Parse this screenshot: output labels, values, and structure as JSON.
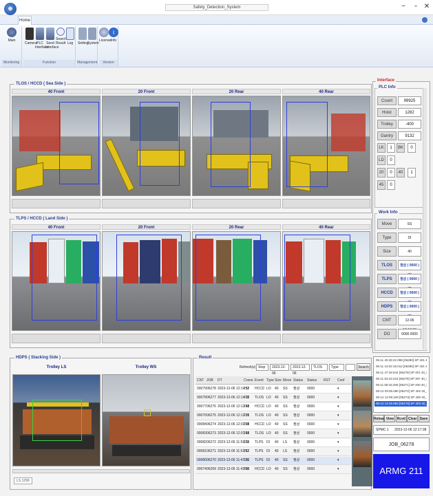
{
  "window": {
    "title": "Safety_Detection_System"
  },
  "ribbon": {
    "tab": "Home",
    "groups": [
      {
        "label": "Monitoring",
        "buttons": [
          "Main"
        ]
      },
      {
        "label": "Function",
        "buttons": [
          "Camera",
          "PLC Interface",
          "Send Interface",
          "Search Result",
          "Log"
        ]
      },
      {
        "label": "Management",
        "buttons": [
          "Setting",
          "System"
        ]
      },
      {
        "label": "Version",
        "buttons": [
          "License",
          "Info"
        ]
      }
    ]
  },
  "sea_side": {
    "title": "TLOS / HCCD ( Sea Side )",
    "cams": [
      "40 Front",
      "20 Front",
      "20 Rear",
      "40 Rear"
    ]
  },
  "land_side": {
    "title": "TLPS / HCCD ( Land Side )",
    "cams": [
      "40 Front",
      "20 Front",
      "20 Rear",
      "40 Rear"
    ]
  },
  "hdps": {
    "title": "HDPS ( Stacking Side )",
    "cams": [
      "Trolley LS",
      "Trolley WS"
    ],
    "scroll_label": "LS 1299"
  },
  "interface": {
    "title": "Interface",
    "plc_info": {
      "title": "PLC Info",
      "rows": [
        {
          "label": "Count",
          "value": "99925"
        },
        {
          "label": "Hoist",
          "value": "1282"
        },
        {
          "label": "Trolley",
          "value": "-400"
        },
        {
          "label": "Gantry",
          "value": "9132"
        }
      ],
      "flags": [
        [
          "LK",
          "1",
          "BK",
          "0"
        ],
        [
          "LD",
          "0",
          "",
          ""
        ],
        [
          "20",
          "0",
          "40",
          "1"
        ],
        [
          "45",
          "0",
          "",
          ""
        ]
      ]
    },
    "work_info": {
      "title": "Work Info",
      "rows": [
        {
          "label": "Move",
          "value": "SS"
        },
        {
          "label": "Type",
          "value": "DI"
        },
        {
          "label": "Size",
          "value": "40"
        },
        {
          "label": "TLOS",
          "value": "정상 ( 0000 ) (0)"
        },
        {
          "label": "TLPS",
          "value": "정상 ( 0000 ) (0)"
        },
        {
          "label": "HCCD",
          "value": "정상 ( 0000 ) (0)"
        },
        {
          "label": "HDPS",
          "value": "정상 ( 0000 ) (0)"
        },
        {
          "label": "CMT",
          "value": "12-06 12:17:38"
        },
        {
          "label": "DO",
          "value": "0000 0000"
        }
      ]
    }
  },
  "result": {
    "title": "Result",
    "refresh_label": "Refresh(s)",
    "refresh_value": "Stop",
    "date_from": "2023-12-06",
    "date_to": "2023-12-06",
    "system": "TLOS",
    "type": "Type",
    "search": "Search",
    "columns": [
      "CNT",
      "JOB",
      "DT",
      "Crane",
      "Event",
      "Type",
      "Size",
      "Move",
      "Status",
      "Status",
      "RST",
      "Conf"
    ],
    "rows": [
      [
        "00079",
        "06278",
        "2023-12-06 12:14:52",
        "211",
        "HCCD",
        "LO",
        "40",
        "SS",
        "정상",
        "0000",
        "",
        "▾"
      ],
      [
        "00078",
        "06277",
        "2023-12-06 12:14:35",
        "211",
        "TLOS",
        "LO",
        "40",
        "SS",
        "정상",
        "0000",
        "",
        "▾"
      ],
      [
        "00077",
        "06276",
        "2023-12-06 12:12:48",
        "211",
        "HCCD",
        "LO",
        "40",
        "SS",
        "정상",
        "0000",
        "",
        "▾"
      ],
      [
        "00076",
        "06275",
        "2023-12-06 12:12:20",
        "211",
        "TLOS",
        "LO",
        "40",
        "SS",
        "정상",
        "0000",
        "",
        "▾"
      ],
      [
        "00084",
        "06274",
        "2023-12-06 12:03:08",
        "211",
        "HCCD",
        "LO",
        "40",
        "SS",
        "정상",
        "0000",
        "",
        "▾"
      ],
      [
        "00083",
        "06273",
        "2023-12-06 12:01:48",
        "211",
        "TLOS",
        "LO",
        "40",
        "SS",
        "정상",
        "0000",
        "",
        "▾"
      ],
      [
        "00082",
        "06272",
        "2023-12-06 11:59:28",
        "211",
        "TLPS",
        "DI",
        "40",
        "LS",
        "정상",
        "0000",
        "",
        "▾"
      ],
      [
        "00081",
        "06271",
        "2023-12-06 11:53:52",
        "211",
        "TLPS",
        "DI",
        "40",
        "LS",
        "정상",
        "0000",
        "",
        "▾"
      ],
      [
        "00080",
        "06270",
        "2023-12-06 11:47:26",
        "211",
        "TLPS",
        "DI",
        "40",
        "SS",
        "정상",
        "0000",
        "",
        "▾"
      ],
      [
        "00074",
        "06269",
        "2023-12-06 11:42:08",
        "211",
        "HCCD",
        "LO",
        "40",
        "SS",
        "정상",
        "0000",
        "",
        "▾"
      ]
    ]
  },
  "job_list": {
    "items": [
      "06-11 40:45:22.098 [06280] SP 401 40_LO_61_A",
      "06-11 41:02:15.012 [06280] SP 401 40_LO_61_B",
      "06-11 47:18:044 [06279] SP 401 40_LO_61",
      "06-11 53:43:418 [06279] SP 307 40_DI_61",
      "06-11 59:18.306 [06271] SP 400 40_DI_61",
      "06-12 03:05.080 [06272] SP 402 40_LO_61",
      "06-12 12:08.349 [06273] SP 400 40_LO_61",
      "06-12 14:45.993 [06278] SP 403 40_LO_61"
    ],
    "selected": 7,
    "buttons": [
      "Reload",
      "View",
      "Rcvd",
      "Clear",
      "Save"
    ],
    "spmc_label": "SPMC 1",
    "spmc_time": "2023-12-06 12:17:38",
    "job": "JOB_06278",
    "crane": "ARMG 211"
  },
  "colors": {
    "accent": "#1a1ae6",
    "title_red": "#c62828",
    "crane_bg": "#1717e8"
  }
}
